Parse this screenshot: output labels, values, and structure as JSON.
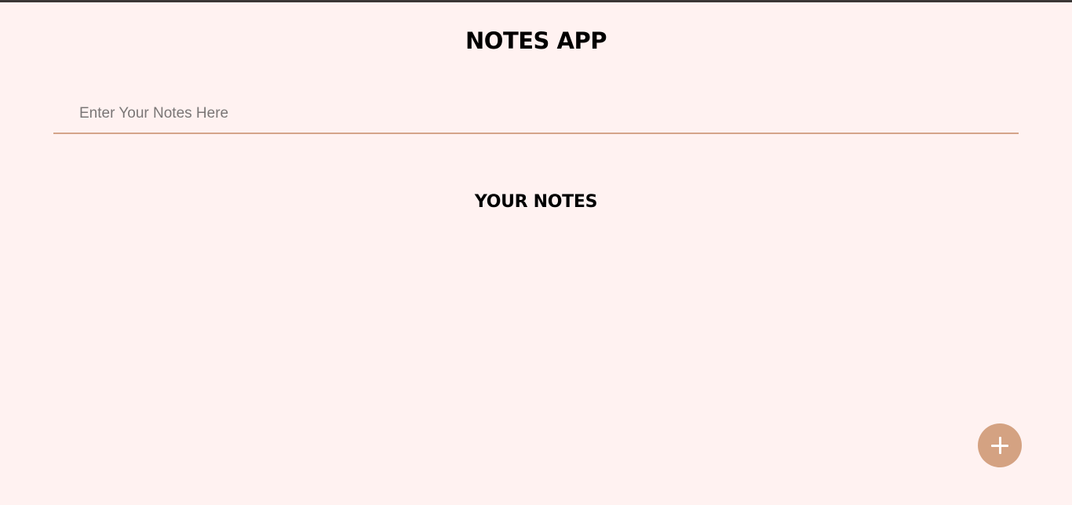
{
  "app": {
    "title": "NOTES APP"
  },
  "note_input": {
    "placeholder": "Enter Your Notes Here",
    "value": ""
  },
  "notes_section": {
    "heading": "YOUR NOTES",
    "notes": []
  },
  "add_button": {
    "icon": "plus-icon",
    "color": "#d4a282"
  },
  "colors": {
    "background": "#fff2f1",
    "accent": "#d4a48a",
    "top_bar": "#3b3836"
  }
}
